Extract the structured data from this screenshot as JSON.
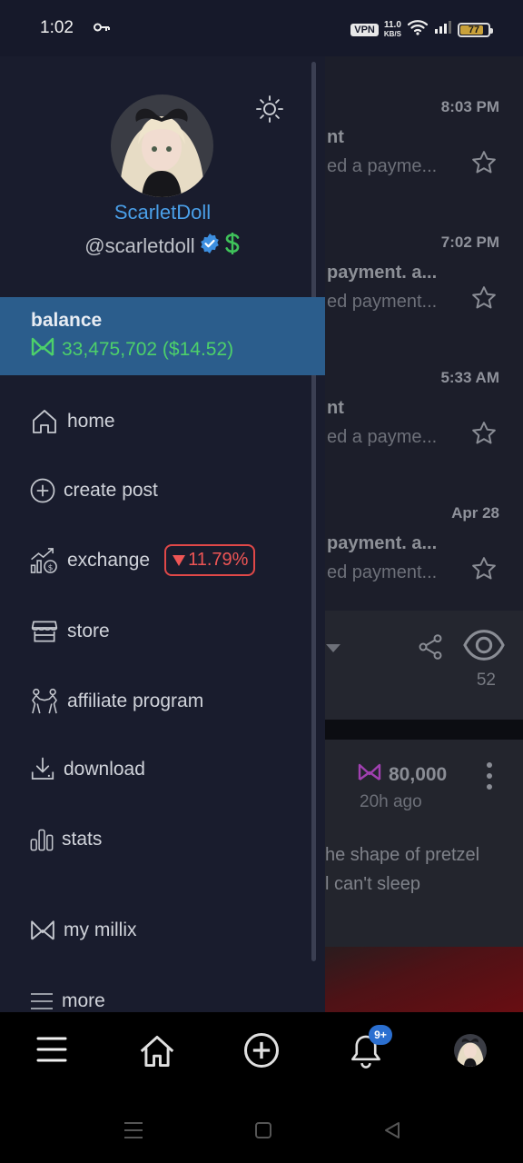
{
  "status_bar": {
    "time": "1:02",
    "vpn": "VPN",
    "net_speed_value": "11.0",
    "net_speed_unit": "KB/S",
    "battery": "77"
  },
  "drawer": {
    "display_name": "ScarletDoll",
    "handle": "@scarletdoll",
    "balance": {
      "label": "balance",
      "amount": "33,475,702 ($14.52)"
    },
    "menu": {
      "home": "home",
      "create_post": "create post",
      "exchange": "exchange",
      "exchange_change": "11.79%",
      "store": "store",
      "affiliate": "affiliate program",
      "download": "download",
      "stats": "stats",
      "my_millix": "my millix",
      "more": "more"
    }
  },
  "feed": {
    "notifications": [
      {
        "time": "8:03 PM",
        "title": "nt",
        "subtitle": "ed a payme..."
      },
      {
        "time": "7:02 PM",
        "title": "payment. a...",
        "subtitle": "ed payment..."
      },
      {
        "time": "5:33 AM",
        "title": "nt",
        "subtitle": "ed a payme..."
      },
      {
        "time": "Apr 28",
        "title": "payment. a...",
        "subtitle": "ed payment..."
      }
    ],
    "view_count": "52",
    "post": {
      "amount": "80,000",
      "age": "20h ago",
      "line1": "he shape of pretzel",
      "line2": "l can't sleep"
    }
  },
  "bottom_nav": {
    "notification_badge": "9+"
  },
  "colors": {
    "drawer_bg": "#191c2d",
    "balance_bg": "#2b5d8c",
    "accent_blue": "#4a9fe8",
    "millix_green": "#4dd06a",
    "down_red": "#ee5555",
    "millix_purple": "#a040b0"
  },
  "icons": [
    "key-icon",
    "wifi-icon",
    "signal-icon",
    "sun-icon",
    "verified-icon",
    "dollar-icon",
    "millix-icon",
    "home-icon",
    "plus-circle-icon",
    "exchange-icon",
    "store-icon",
    "affiliate-icon",
    "download-icon",
    "stats-icon",
    "menu-icon",
    "bell-icon",
    "star-icon",
    "share-icon",
    "eye-icon",
    "kebab-icon"
  ]
}
